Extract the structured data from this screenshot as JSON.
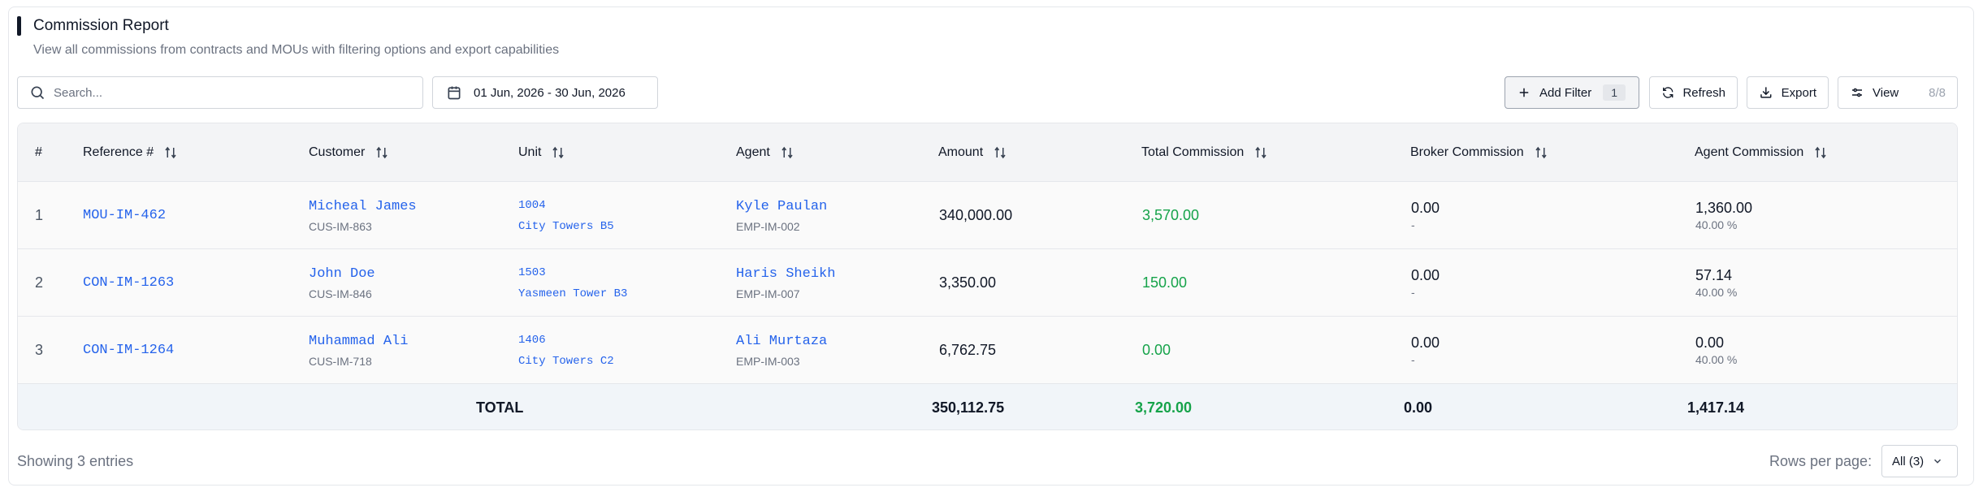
{
  "header": {
    "title": "Commission Report",
    "subtitle": "View all commissions from contracts and MOUs with filtering options and export capabilities"
  },
  "toolbar": {
    "search_placeholder": "Search...",
    "date_range": "01 Jun, 2026 - 30 Jun, 2026",
    "add_filter_label": "Add Filter",
    "filter_count": "1",
    "refresh_label": "Refresh",
    "export_label": "Export",
    "view_label": "View",
    "view_count": "8/8"
  },
  "table": {
    "columns": [
      "#",
      "Reference #",
      "Customer",
      "Unit",
      "Agent",
      "Amount",
      "Total Commission",
      "Broker Commission",
      "Agent Commission"
    ],
    "rows": [
      {
        "index": "1",
        "reference": "MOU-IM-462",
        "customer_name": "Micheal James",
        "customer_id": "CUS-IM-863",
        "unit_number": "1004",
        "unit_building": "City Towers B5",
        "agent_name": "Kyle Paulan",
        "agent_id": "EMP-IM-002",
        "amount": "340,000.00",
        "total_commission": "3,570.00",
        "broker_commission": "0.00",
        "broker_sub": "-",
        "agent_commission": "1,360.00",
        "agent_percent": "40.00 %"
      },
      {
        "index": "2",
        "reference": "CON-IM-1263",
        "customer_name": "John Doe",
        "customer_id": "CUS-IM-846",
        "unit_number": "1503",
        "unit_building": "Yasmeen Tower B3",
        "agent_name": "Haris Sheikh",
        "agent_id": "EMP-IM-007",
        "amount": "3,350.00",
        "total_commission": "150.00",
        "broker_commission": "0.00",
        "broker_sub": "-",
        "agent_commission": "57.14",
        "agent_percent": "40.00 %"
      },
      {
        "index": "3",
        "reference": "CON-IM-1264",
        "customer_name": "Muhammad Ali",
        "customer_id": "CUS-IM-718",
        "unit_number": "1406",
        "unit_building": "City Towers C2",
        "agent_name": "Ali Murtaza",
        "agent_id": "EMP-IM-003",
        "amount": "6,762.75",
        "total_commission": "0.00",
        "broker_commission": "0.00",
        "broker_sub": "-",
        "agent_commission": "0.00",
        "agent_percent": "40.00 %"
      }
    ],
    "totals": {
      "label": "TOTAL",
      "amount": "350,112.75",
      "total_commission": "3,720.00",
      "broker_commission": "0.00",
      "agent_commission": "1,417.14"
    }
  },
  "footer": {
    "showing": "Showing 3 entries",
    "rows_per_page_label": "Rows per page:",
    "rows_per_page_value": "All (3)"
  },
  "colors": {
    "link": "#2563eb",
    "positive": "#16a34a",
    "header_bg": "#f3f4f6"
  }
}
